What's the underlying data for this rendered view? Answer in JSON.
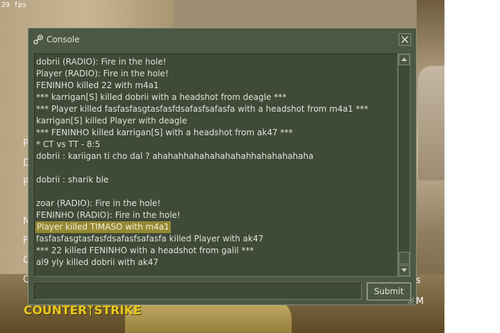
{
  "hud": {
    "fps": "29 fps"
  },
  "menu_letters": [
    "P",
    "D",
    "P",
    "N",
    "F",
    "C",
    "Q"
  ],
  "logo": {
    "text_a": "Counter",
    "text_b": "Strike"
  },
  "side_letters": {
    "s": "s",
    "m": "M"
  },
  "console": {
    "title": "Console",
    "lines": [
      "dobrii (RADIO): Fire in the hole!",
      "Player (RADIO): Fire in the hole!",
      "FENINHO killed 22 with m4a1",
      "*** karrigan[S] killed dobrii with a headshot from deagle ***",
      "*** Player killed fasfasfasgtasfasfdsafasfsafasfa with a headshot from m4a1 ***",
      "karrigan[S] killed Player with deagle",
      "*** FENINHO killed karrigan[S] with a headshot from ak47 ***",
      "*  CT vs TT - 8:5",
      "dobrii :  kariigan ti cho dal ? ahahahhahahahahahahhahahahahaha",
      "",
      "dobrii :  sharik ble",
      "",
      "zoar (RADIO): Fire in the hole!",
      "FENINHO (RADIO): Fire in the hole!",
      "Player killed TIMASO with m4a1",
      "fasfasfasgtasfasfdsafasfsafasfa killed Player with ak47",
      "*** 22 killed FENINHO with a headshot from galil ***",
      "al9 yly killed dobrii with ak47"
    ],
    "highlighted_line": 14,
    "input_value": "",
    "submit_label": "Submit"
  },
  "colors": {
    "panel": "#4c5844",
    "text": "#dfe3d8",
    "highlight": "#958834",
    "logo": "#e8c820"
  }
}
